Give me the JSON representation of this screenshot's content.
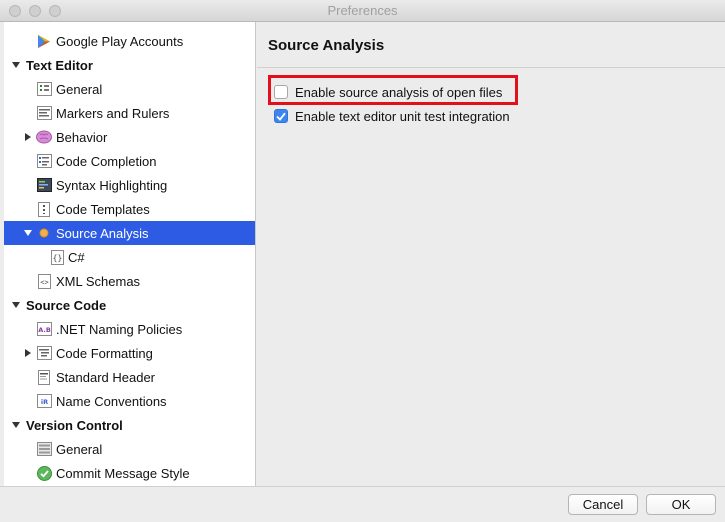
{
  "window": {
    "title": "Preferences"
  },
  "sidebar": {
    "items": [
      {
        "label": "Google Play Accounts",
        "type": "item",
        "icon": "google-play-icon"
      },
      {
        "label": "Text Editor",
        "type": "header"
      },
      {
        "label": "General",
        "type": "item",
        "icon": "general-icon"
      },
      {
        "label": "Markers and Rulers",
        "type": "item",
        "icon": "markers-icon"
      },
      {
        "label": "Behavior",
        "type": "item",
        "icon": "brain-icon",
        "expandable": true
      },
      {
        "label": "Code Completion",
        "type": "item",
        "icon": "code-completion-icon"
      },
      {
        "label": "Syntax Highlighting",
        "type": "item",
        "icon": "syntax-icon"
      },
      {
        "label": "Code Templates",
        "type": "item",
        "icon": "templates-icon"
      },
      {
        "label": "Source Analysis",
        "type": "item",
        "icon": "dot-icon",
        "selected": true,
        "expanded": true
      },
      {
        "label": "C#",
        "type": "subitem",
        "icon": "braces-icon"
      },
      {
        "label": "XML Schemas",
        "type": "item",
        "icon": "xml-icon"
      },
      {
        "label": "Source Code",
        "type": "header"
      },
      {
        "label": ".NET Naming Policies",
        "type": "item",
        "icon": "naming-icon"
      },
      {
        "label": "Code Formatting",
        "type": "item",
        "icon": "formatting-icon",
        "expandable": true
      },
      {
        "label": "Standard Header",
        "type": "item",
        "icon": "header-icon"
      },
      {
        "label": "Name Conventions",
        "type": "item",
        "icon": "name-conventions-icon"
      },
      {
        "label": "Version Control",
        "type": "header"
      },
      {
        "label": "General",
        "type": "item",
        "icon": "vc-general-icon"
      },
      {
        "label": "Commit Message Style",
        "type": "item",
        "icon": "commit-check-icon"
      }
    ]
  },
  "main": {
    "title": "Source Analysis",
    "options": [
      {
        "label": "Enable source analysis of open files",
        "checked": false
      },
      {
        "label": "Enable text editor unit test integration",
        "checked": true
      }
    ]
  },
  "footer": {
    "cancel_label": "Cancel",
    "ok_label": "OK"
  },
  "colors": {
    "selection": "#2d5be3",
    "checkbox_checked": "#3b86ef",
    "highlight": "#e3101c"
  }
}
